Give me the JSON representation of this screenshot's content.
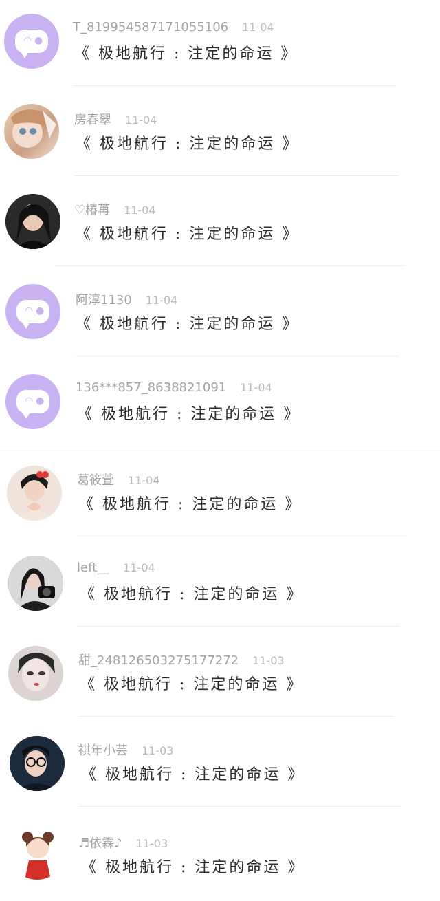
{
  "comments": [
    {
      "username": "T_8199545871710551​06",
      "date": "11-04",
      "text": "《 极地航行 : 注定的命运 》",
      "avatar": "default-avatar",
      "color": "#c9b2f2"
    },
    {
      "username": "房春翠",
      "date": "11-04",
      "text": "《 极地航行 : 注定的命运 》",
      "avatar": "anime-girl-avatar",
      "color": "#d9b99b"
    },
    {
      "username": "♡椿苒",
      "date": "11-04",
      "text": "《 极地航行 : 注定的命运 》",
      "avatar": "woman-photo-avatar",
      "color": "#3a3a3a"
    },
    {
      "username": "阿淳1130",
      "date": "11-04",
      "text": "《 极地航行 : 注定的命运 》",
      "avatar": "default-avatar",
      "color": "#c9b2f2"
    },
    {
      "username": "136***857_8638821091",
      "date": "11-04",
      "text": "《 极地航行 : 注定的命运 》",
      "avatar": "default-avatar",
      "color": "#c9b2f2"
    },
    {
      "username": "葛筱萱",
      "date": "11-04",
      "text": "《 极地航行 : 注定的命运 》",
      "avatar": "girl-bow-avatar",
      "color": "#e7c3b6"
    },
    {
      "username": "left__",
      "date": "11-04",
      "text": "《 极地航行 : 注定的命运 》",
      "avatar": "girl-camera-avatar",
      "color": "#4a4a4a"
    },
    {
      "username": "甜_248126503275177272",
      "date": "11-03",
      "text": "《 极地航行 : 注定的命运 》",
      "avatar": "painted-face-avatar",
      "color": "#8a7a7a"
    },
    {
      "username": "祺年小芸",
      "date": "11-03",
      "text": "《 极地航行 : 注定的命运 》",
      "avatar": "boy-glasses-avatar",
      "color": "#2b2b2b"
    },
    {
      "username": "♬依霖♪",
      "date": "11-03",
      "text": "《 极地航行 : 注定的命运 》",
      "avatar": "cartoon-doll-avatar",
      "color": "#f2d6c2"
    }
  ]
}
